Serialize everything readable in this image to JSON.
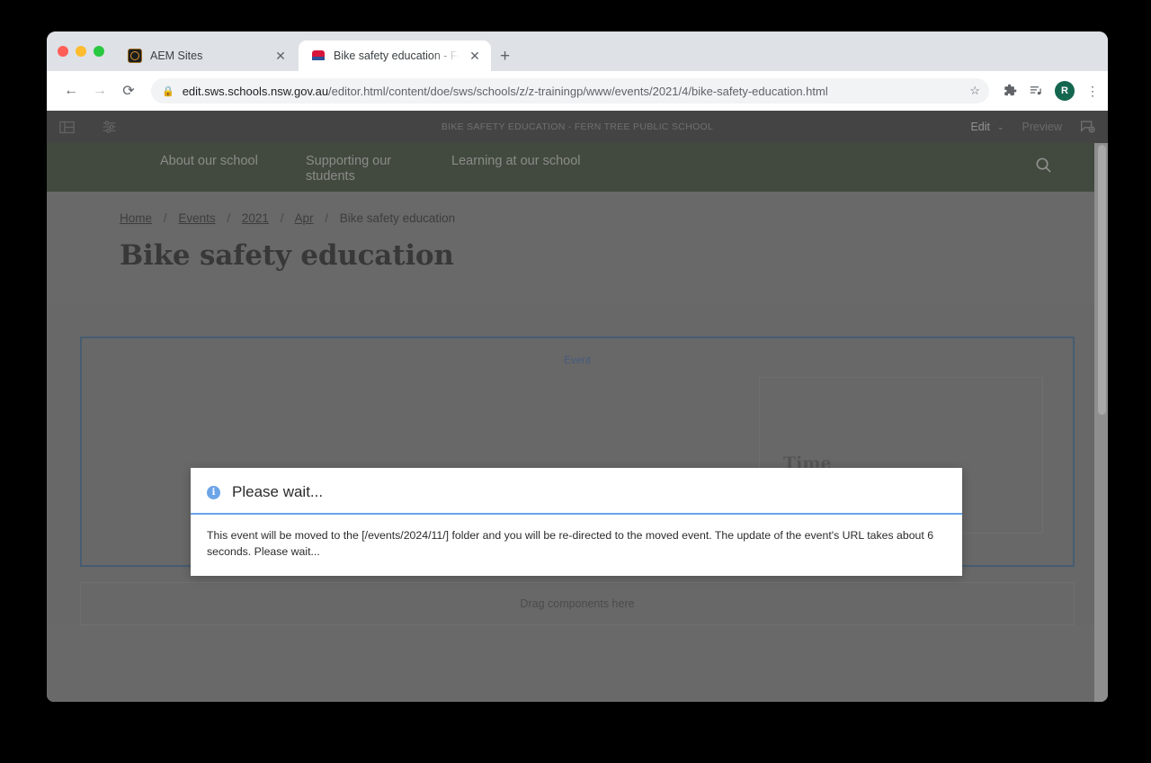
{
  "browser": {
    "tabs": [
      {
        "title": "AEM Sites",
        "favicon": "aem-logo-icon",
        "active": false
      },
      {
        "title": "Bike safety education - Fern Tr",
        "favicon": "nsw-gov-icon",
        "active": true
      }
    ],
    "new_tab_label": "+",
    "close_label": "✕",
    "nav": {
      "back": "←",
      "forward": "→",
      "reload": "⟳"
    },
    "omnibox": {
      "lock_icon": "lock-icon",
      "url_domain": "edit.sws.schools.nsw.gov.au",
      "url_path": "/editor.html/content/doe/sws/schools/z/z-trainingp/www/events/2021/4/bike-safety-education.html",
      "star_icon": "☆"
    },
    "toolbar_icons": {
      "extensions": "puzzle-piece-icon",
      "reading_list": "reading-list-icon",
      "avatar_initial": "R",
      "menu": "⋮"
    }
  },
  "aem_toolbar": {
    "rail_toggle": "side-panel-icon",
    "page_properties": "sliders-icon",
    "title": "BIKE SAFETY EDUCATION - FERN TREE PUBLIC SCHOOL",
    "mode_label": "Edit",
    "mode_chevron": "⌄",
    "preview_label": "Preview",
    "page_info_icon": "page-info-icon"
  },
  "site_nav": {
    "items": [
      "About our school",
      "Supporting our students",
      "Learning at our school"
    ],
    "search_icon": "search-icon"
  },
  "page": {
    "breadcrumb": [
      {
        "label": "Home",
        "link": true
      },
      {
        "label": "Events",
        "link": true
      },
      {
        "label": "2021",
        "link": true
      },
      {
        "label": "Apr",
        "link": true
      },
      {
        "label": "Bike safety education",
        "link": false
      }
    ],
    "breadcrumb_separator": "/",
    "title": "Bike safety education"
  },
  "editor": {
    "component_label": "Event",
    "time_heading": "Time",
    "clock_icon": "clock-icon",
    "dropzone_label": "Drag components here"
  },
  "modal": {
    "icon": "info-icon",
    "icon_glyph": "i",
    "title": "Please wait...",
    "message": "This event will be moved to the [/events/2024/11/] folder and you will be re-directed to the moved event. The update of the event's URL takes about 6 seconds. Please wait..."
  },
  "colors": {
    "nav_green": "#27361f",
    "accent_blue": "#2f5f8f",
    "info_blue": "#6ca4e8",
    "avatar_green": "#14674f"
  }
}
